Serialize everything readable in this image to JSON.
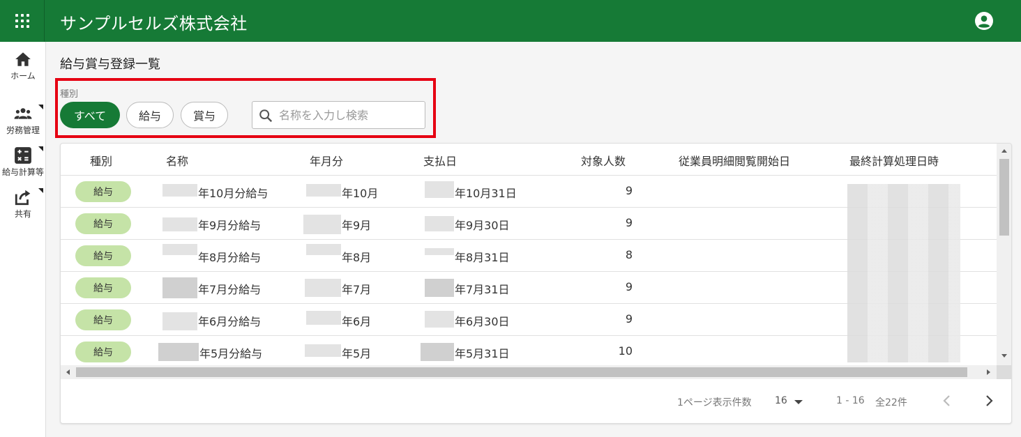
{
  "header": {
    "app_title": "サンプルセルズ株式会社",
    "menu_icon": "apps-grid-icon",
    "account_icon": "account-circle-icon",
    "bar_color": "#167a36"
  },
  "sidebar": {
    "items": [
      {
        "label": "ホーム",
        "icon": "home-icon"
      },
      {
        "label": "労務管理",
        "icon": "people-icon"
      },
      {
        "label": "給与計算等",
        "icon": "calculator-icon"
      },
      {
        "label": "共有",
        "icon": "share-icon"
      }
    ]
  },
  "page": {
    "title": "給与賞与登録一覧"
  },
  "filter": {
    "label": "種別",
    "chips": [
      "すべて",
      "給与",
      "賞与"
    ],
    "selected": "すべて",
    "search_placeholder": "名称を入力し検索",
    "search_value": ""
  },
  "table": {
    "columns": [
      "種別",
      "名称",
      "年月分",
      "支払日",
      "対象人数",
      "従業員明細閲覧開始日",
      "最終計算処理日時"
    ],
    "rows": [
      {
        "type": "給与",
        "name": "年10月分給与",
        "period": "年10月",
        "pay_date": "年10月31日",
        "count": "9",
        "view_start": ""
      },
      {
        "type": "給与",
        "name": "年9月分給与",
        "period": "年9月",
        "pay_date": "年9月30日",
        "count": "9",
        "view_start": ""
      },
      {
        "type": "給与",
        "name": "年8月分給与",
        "period": "年8月",
        "pay_date": "年8月31日",
        "count": "8",
        "view_start": ""
      },
      {
        "type": "給与",
        "name": "年7月分給与",
        "period": "年7月",
        "pay_date": "年7月31日",
        "count": "9",
        "view_start": ""
      },
      {
        "type": "給与",
        "name": "年6月分給与",
        "period": "年6月",
        "pay_date": "年6月30日",
        "count": "9",
        "view_start": ""
      },
      {
        "type": "給与",
        "name": "年5月分給与",
        "period": "年5月",
        "pay_date": "年5月31日",
        "count": "10",
        "view_start": ""
      }
    ]
  },
  "footer": {
    "rows_per_page_label": "1ページ表示件数",
    "rows_per_page": "16",
    "range": "1 - 16",
    "total": "全22件"
  }
}
